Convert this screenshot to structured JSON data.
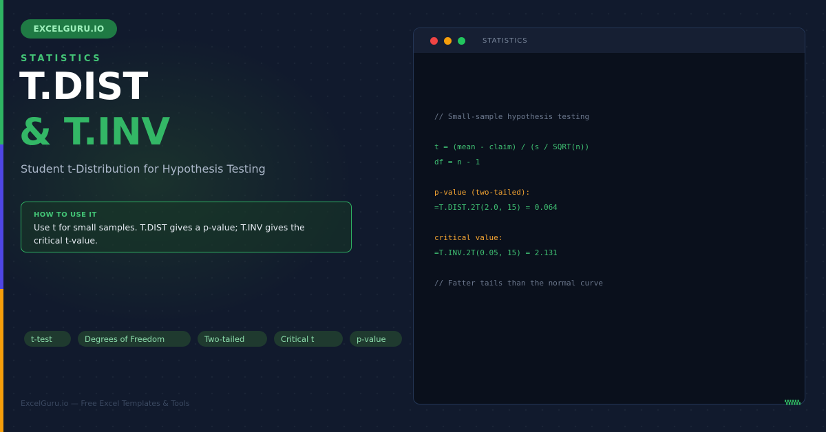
{
  "brand": "EXCELGURU.IO",
  "category": "STATISTICS",
  "title": {
    "line1": "T.DIST",
    "line2": "& T.INV"
  },
  "subtitle": "Student t-Distribution for Hypothesis Testing",
  "howto": {
    "label": "HOW TO USE IT",
    "text": "Use t for small samples. T.DIST gives a p-value; T.INV gives the critical t-value."
  },
  "tags": [
    "t-test",
    "Degrees of Freedom",
    "Two-tailed",
    "Critical t",
    "p-value"
  ],
  "footer": "ExcelGuru.io — Free Excel Templates & Tools",
  "window": {
    "title": "STATISTICS",
    "code": {
      "comment1": "// Small-sample hypothesis testing",
      "line_t": "t = (mean - claim) / (s / SQRT(n))",
      "line_df": "df = n - 1",
      "pvalue_label": "p-value (two-tailed):",
      "pvalue_formula": "=T.DIST.2T(2.0, 15) = 0.064",
      "critical_label": "critical value:",
      "critical_formula": "=T.INV.2T(0.05, 15) = 2.131",
      "comment2": "// Fatter tails than the normal curve"
    }
  },
  "colors": {
    "accent_green": "#2fb463",
    "accent_blue": "#4f46e5",
    "accent_orange": "#f59e0b",
    "background": "#111a2d"
  }
}
